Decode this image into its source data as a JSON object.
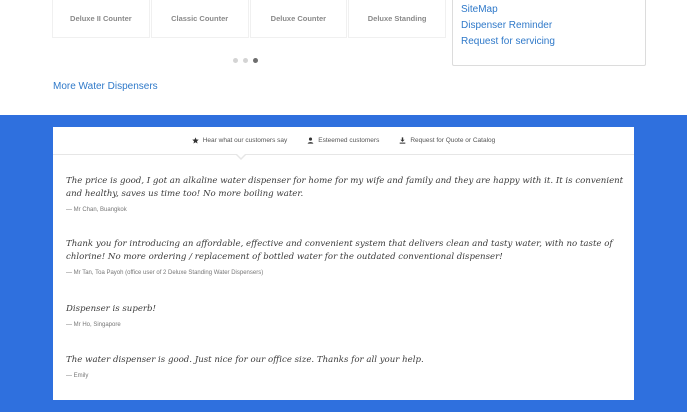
{
  "products": [
    {
      "name": "Deluxe II Counter"
    },
    {
      "name": "Classic Counter"
    },
    {
      "name": "Deluxe Counter"
    },
    {
      "name": "Deluxe Standing"
    }
  ],
  "carousel": {
    "total": 3,
    "active_index": 2
  },
  "more_link": "More Water Dispensers",
  "side_links": [
    "SiteMap",
    "Dispenser Reminder",
    "Request for servicing"
  ],
  "tabs": [
    {
      "label": "Hear what our customers say",
      "icon": "star-icon",
      "active": true
    },
    {
      "label": "Esteemed customers",
      "icon": "user-icon",
      "active": false
    },
    {
      "label": "Request for Quote or Catalog",
      "icon": "download-icon",
      "active": false
    }
  ],
  "testimonials": [
    {
      "quote": "The price is good, I got an alkaline water dispenser for home for my wife and family and they are happy with it. It is convenient and healthy, saves us time too! No more boiling water.",
      "author": "— Mr Chan, Buangkok"
    },
    {
      "quote": "Thank you for introducing an affordable, effective and convenient system that delivers clean and tasty water, with no taste of chlorine! No more ordering / replacement of bottled water for the outdated conventional dispenser!",
      "author": "— Mr Tan, Toa Payoh (office user of 2 Deluxe Standing Water Dispensers)"
    },
    {
      "quote": "Dispenser is superb!",
      "author": "— Mr Ho, Singapore"
    },
    {
      "quote": "The water dispenser is good. Just nice for our office size. Thanks for all your help.",
      "author": "— Emily"
    }
  ],
  "colors": {
    "brand_blue": "#2f70de",
    "link_blue": "#2f79c9"
  }
}
